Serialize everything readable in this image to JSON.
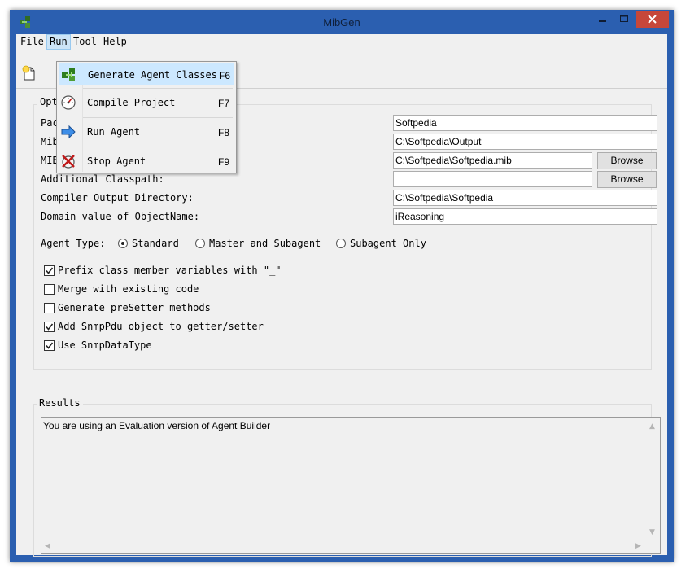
{
  "window": {
    "title": "MibGen",
    "minimize_icon": "minimize-icon",
    "maximize_icon": "maximize-icon",
    "close_icon": "close-icon",
    "frame_color": "#2b5fb0",
    "close_color": "#c7473a"
  },
  "menubar": {
    "file": "File",
    "run": "Run",
    "tool": "Tool",
    "help": "Help"
  },
  "run_menu": {
    "items": [
      {
        "label": "Generate Agent Classes",
        "shortcut": "F6",
        "icon": "generate-classes-icon"
      },
      {
        "label": "Compile Project",
        "shortcut": "F7",
        "icon": "compile-gauge-icon"
      },
      {
        "label": "Run Agent",
        "shortcut": "F8",
        "icon": "run-arrow-icon"
      },
      {
        "label": "Stop Agent",
        "shortcut": "F9",
        "icon": "stop-agent-icon"
      }
    ],
    "highlight_color": "#cce8ff"
  },
  "options": {
    "group_label": "Opt",
    "labels": {
      "package": "Pac",
      "mib_dir": "Mib",
      "mib_file": "MIB",
      "classpath": "Additional Classpath:",
      "compiler_output": "Compiler Output Directory:",
      "domain": "Domain value of ObjectName:"
    },
    "values": {
      "package": "Softpedia",
      "mib_dir": "C:\\Softpedia\\Output",
      "mib_file": "C:\\Softpedia\\Softpedia.mib",
      "classpath": "",
      "compiler_output": "C:\\Softpedia\\Softpedia",
      "domain": "iReasoning"
    },
    "browse_label": "Browse",
    "agent_type": {
      "label": "Agent Type:",
      "options": [
        "Standard",
        "Master and Subagent",
        "Subagent Only"
      ],
      "selected": "Standard"
    },
    "checkboxes": [
      {
        "label": "Prefix class member variables with \"_\"",
        "checked": true
      },
      {
        "label": "Merge with existing code",
        "checked": false
      },
      {
        "label": "Generate preSetter methods",
        "checked": false
      },
      {
        "label": "Add SnmpPdu object to getter/setter",
        "checked": true
      },
      {
        "label": "Use SnmpDataType",
        "checked": true
      }
    ]
  },
  "results": {
    "group_label": "Results",
    "text": "You are using an Evaluation version of Agent Builder"
  },
  "toolbar": {
    "new_icon": "new-project-icon"
  }
}
